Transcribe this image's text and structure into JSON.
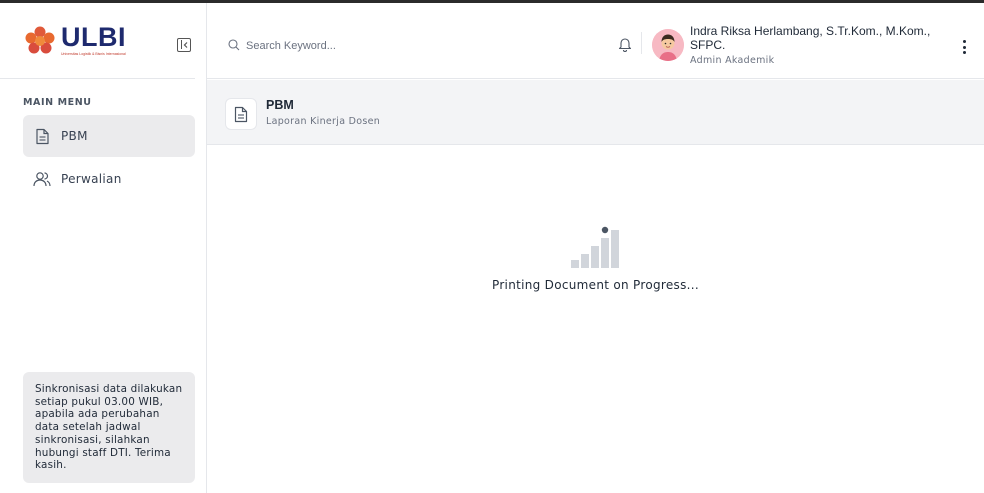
{
  "brand": {
    "name": "ULBI",
    "tagline": "Universitas Logistik & Bisnis Internasional"
  },
  "sidebar": {
    "section_label": "MAIN MENU",
    "items": [
      {
        "label": "PBM",
        "icon": "document-icon",
        "active": true
      },
      {
        "label": "Perwalian",
        "icon": "users-icon",
        "active": false
      }
    ],
    "info": "Sinkronisasi data dilakukan setiap pukul 03.00 WIB, apabila ada perubahan data setelah jadwal sinkronisasi, silahkan hubungi staff DTI. Terima kasih."
  },
  "header": {
    "search_placeholder": "Search Keyword...",
    "user_name": "Indra Riksa Herlambang, S.Tr.Kom., M.Kom., SFPC.",
    "user_role": "Admin Akademik"
  },
  "page": {
    "title": "PBM",
    "subtitle": "Laporan Kinerja Dosen"
  },
  "main": {
    "status": "Printing Document on Progress..."
  },
  "colors": {
    "brand_navy": "#1e2a6e",
    "brand_red": "#e05a3a",
    "active_bg": "#ebebed",
    "loader_dot": "#4b5563",
    "loader_bar": "#d1d5db"
  }
}
